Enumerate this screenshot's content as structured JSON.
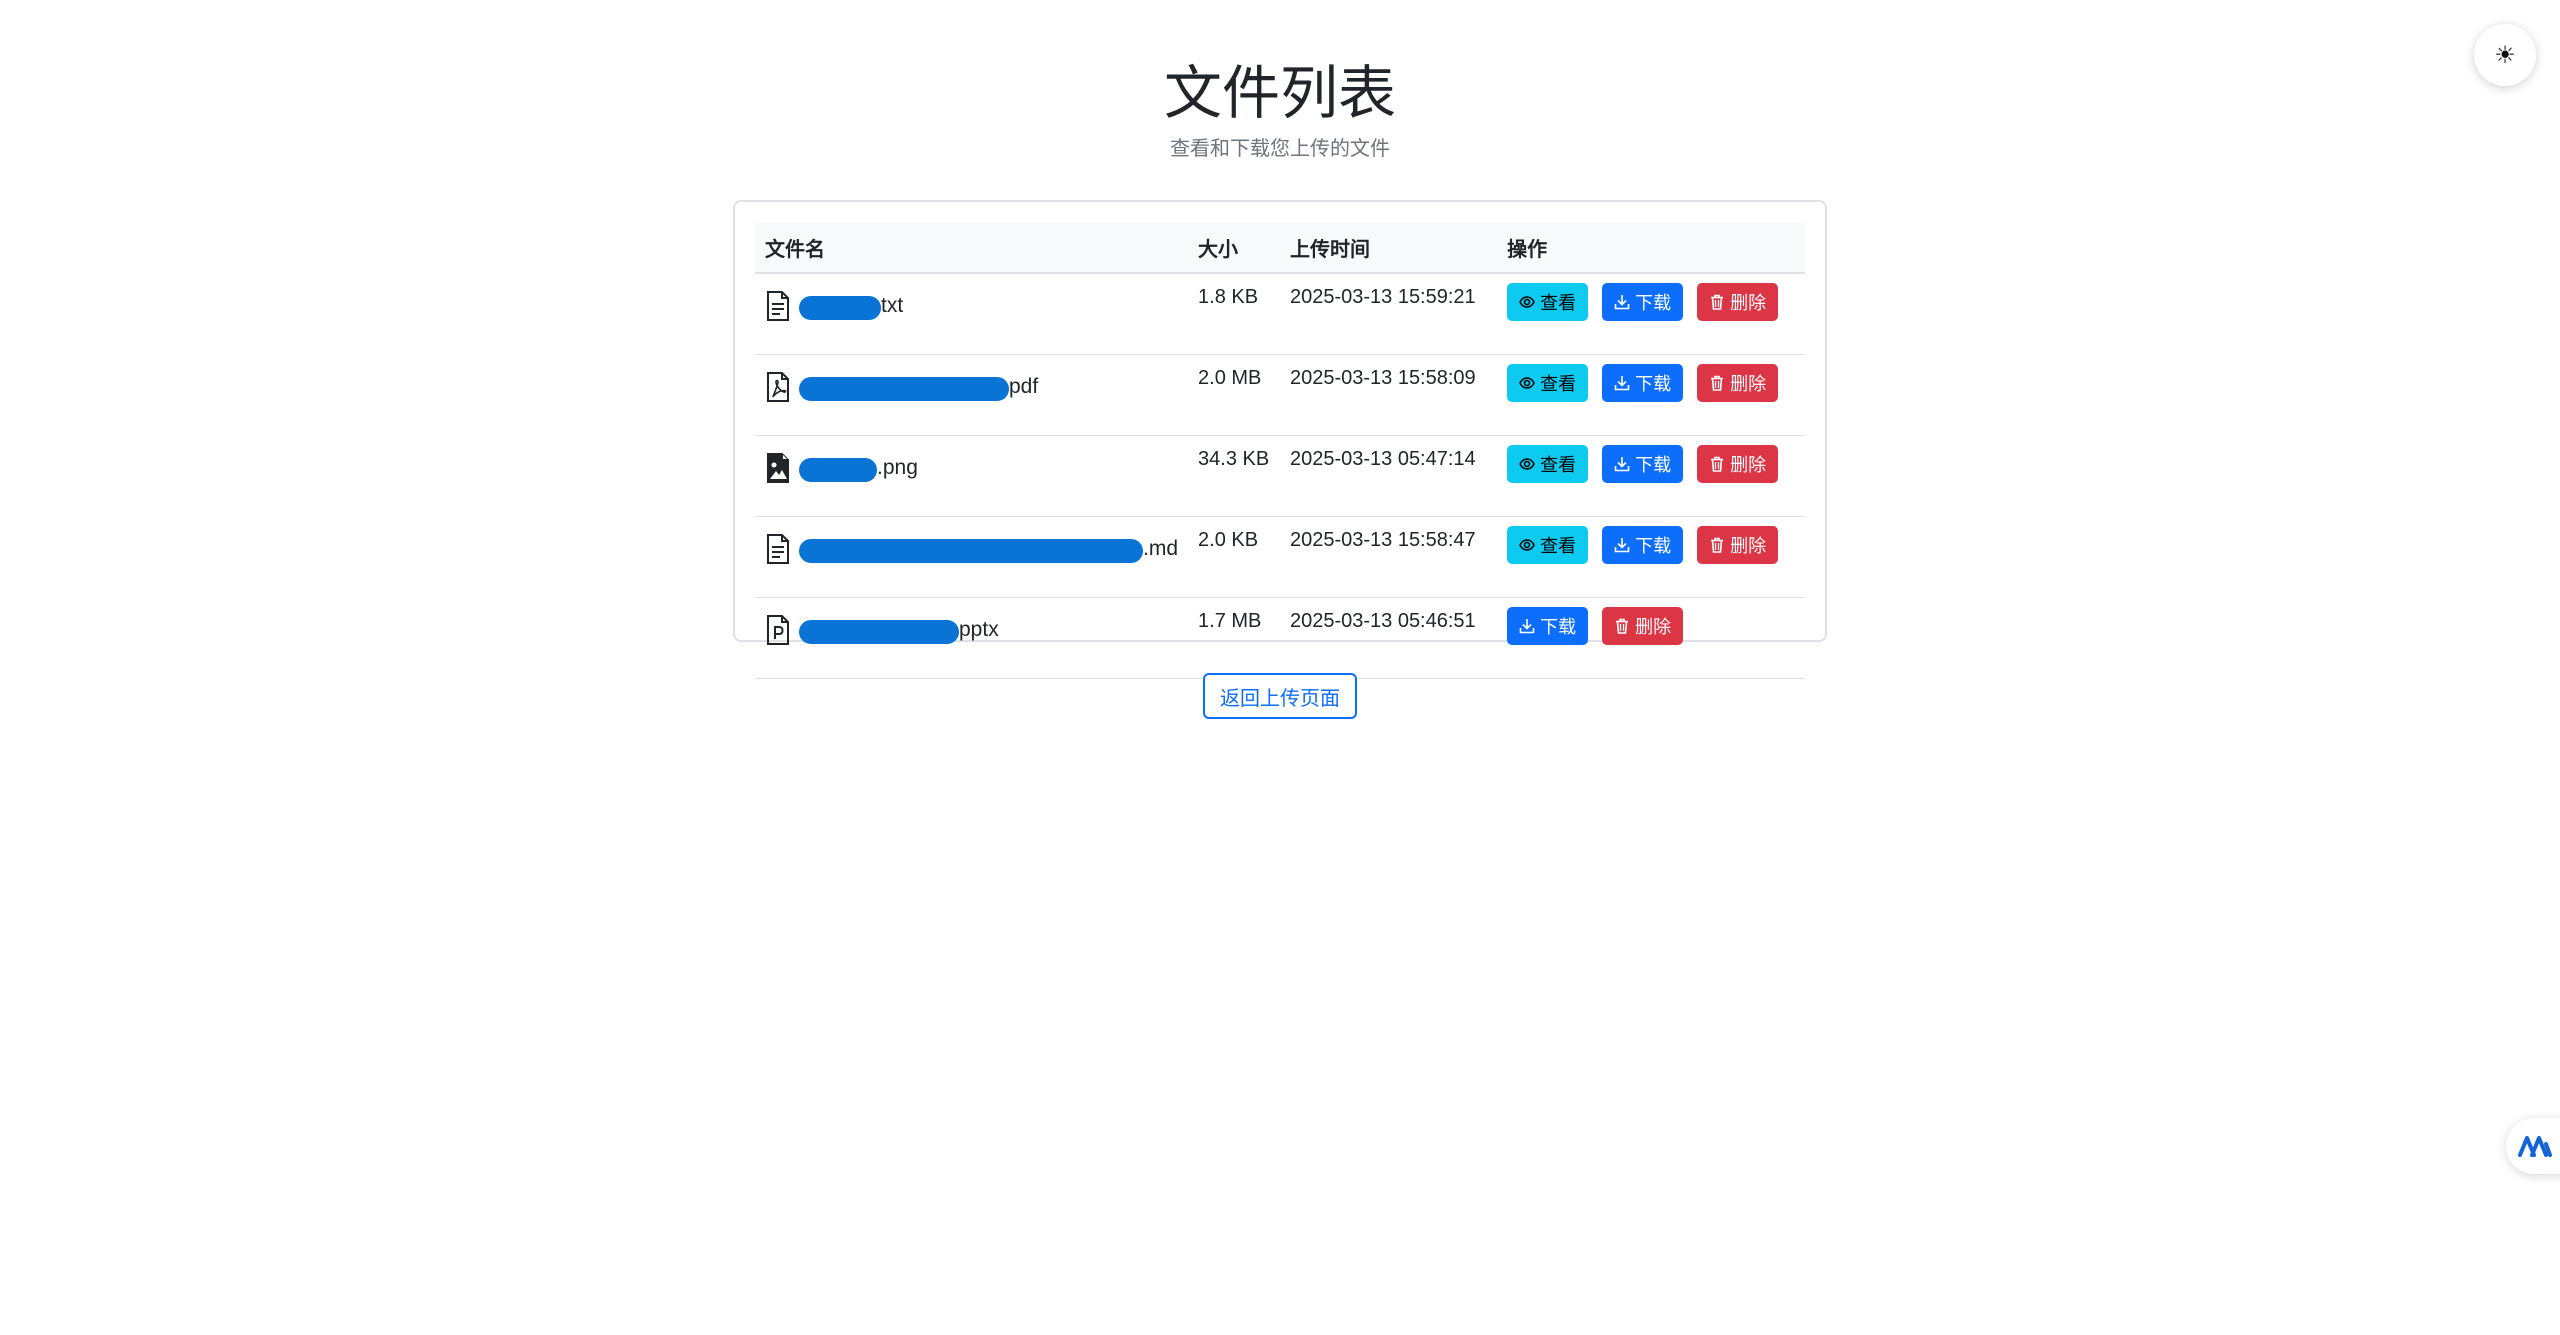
{
  "theme_toggle": {
    "icon": "sun-icon",
    "glyph": "☀"
  },
  "header": {
    "title": "文件列表",
    "subtitle": "查看和下载您上传的文件"
  },
  "table": {
    "columns": [
      "文件名",
      "大小",
      "上传时间",
      "操作"
    ],
    "rows": [
      {
        "icon": "text-file-icon",
        "name_suffix": "txt",
        "size": "1.8 KB",
        "uploaded": "2025-03-13 15:59:21",
        "actions": [
          "查看",
          "下载",
          "删除"
        ]
      },
      {
        "icon": "pdf-file-icon",
        "name_suffix": "pdf",
        "size": "2.0 MB",
        "uploaded": "2025-03-13 15:58:09",
        "actions": [
          "查看",
          "下载",
          "删除"
        ]
      },
      {
        "icon": "image-file-icon",
        "name_suffix": ".png",
        "size": "34.3 KB",
        "uploaded": "2025-03-13 05:47:14",
        "actions": [
          "查看",
          "下载",
          "删除"
        ]
      },
      {
        "icon": "text-file-icon",
        "name_suffix": ".md",
        "size": "2.0 KB",
        "uploaded": "2025-03-13 15:58:47",
        "actions": [
          "查看",
          "下载",
          "删除"
        ]
      },
      {
        "icon": "ppt-file-icon",
        "name_suffix": "pptx",
        "size": "1.7 MB",
        "uploaded": "2025-03-13 05:46:51",
        "actions": [
          "下载",
          "删除"
        ]
      }
    ]
  },
  "buttons": {
    "view": "查看",
    "download": "下载",
    "delete": "删除"
  },
  "return_button": "返回上传页面",
  "colors": {
    "view": "#0dcaf0",
    "download": "#0d6efd",
    "delete": "#dc3545",
    "redaction": "#0a74d6"
  }
}
